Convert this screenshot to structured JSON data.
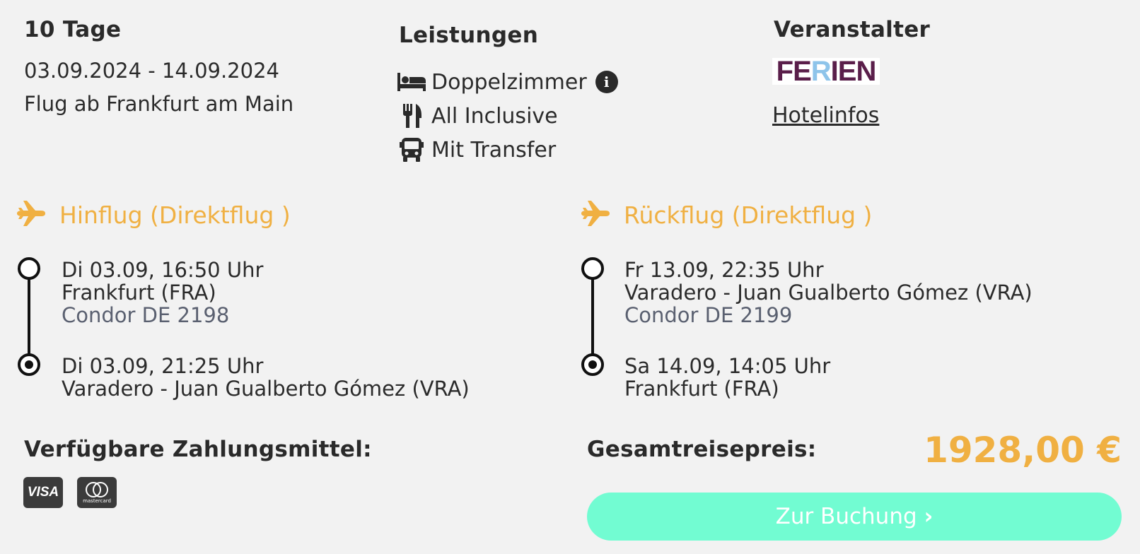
{
  "trip": {
    "duration": "10 Tage",
    "dates": "03.09.2024 - 14.09.2024",
    "departure_city": "Flug ab Frankfurt am Main"
  },
  "leistungen": {
    "heading": "Leistungen",
    "items": [
      {
        "icon": "bed-icon",
        "label": "Doppelzimmer",
        "has_info": true
      },
      {
        "icon": "utensils-icon",
        "label": "All Inclusive"
      },
      {
        "icon": "bus-icon",
        "label": "Mit Transfer"
      }
    ],
    "info_symbol": "i"
  },
  "veranstalter": {
    "heading": "Veranstalter",
    "logo_text": [
      "FE",
      "R",
      "IEN"
    ],
    "logo_colors": [
      "#5a1e4a",
      "#8ec4ea",
      "#5a1e4a"
    ],
    "hotel_link": "Hotelinfos"
  },
  "outbound": {
    "title": "Hinflug (Direktflug )",
    "departure": {
      "time": "Di 03.09, 16:50 Uhr",
      "airport": "Frankfurt (FRA)",
      "carrier": "Condor DE 2198"
    },
    "arrival": {
      "time": "Di 03.09, 21:25 Uhr",
      "airport": "Varadero - Juan Gualberto Gómez (VRA)"
    }
  },
  "return": {
    "title": "Rückflug (Direktflug )",
    "departure": {
      "time": "Fr 13.09, 22:35 Uhr",
      "airport": "Varadero - Juan Gualberto Gómez (VRA)",
      "carrier": "Condor DE 2199"
    },
    "arrival": {
      "time": "Sa 14.09, 14:05 Uhr",
      "airport": "Frankfurt (FRA)"
    }
  },
  "payment": {
    "heading": "Verfügbare Zahlungsmittel:",
    "methods": [
      {
        "icon": "visa-icon",
        "label": "VISA"
      },
      {
        "icon": "mastercard-icon",
        "label": "mastercard"
      }
    ]
  },
  "total": {
    "label": "Gesamtreisepreis:",
    "price": "1928,00 €"
  },
  "cta": {
    "label": "Zur Buchung",
    "chevron": "›"
  },
  "colors": {
    "accent": "#f0b042",
    "button": "#72fcd2",
    "background": "#f2f2f2",
    "carrier_text": "#5a6070"
  }
}
